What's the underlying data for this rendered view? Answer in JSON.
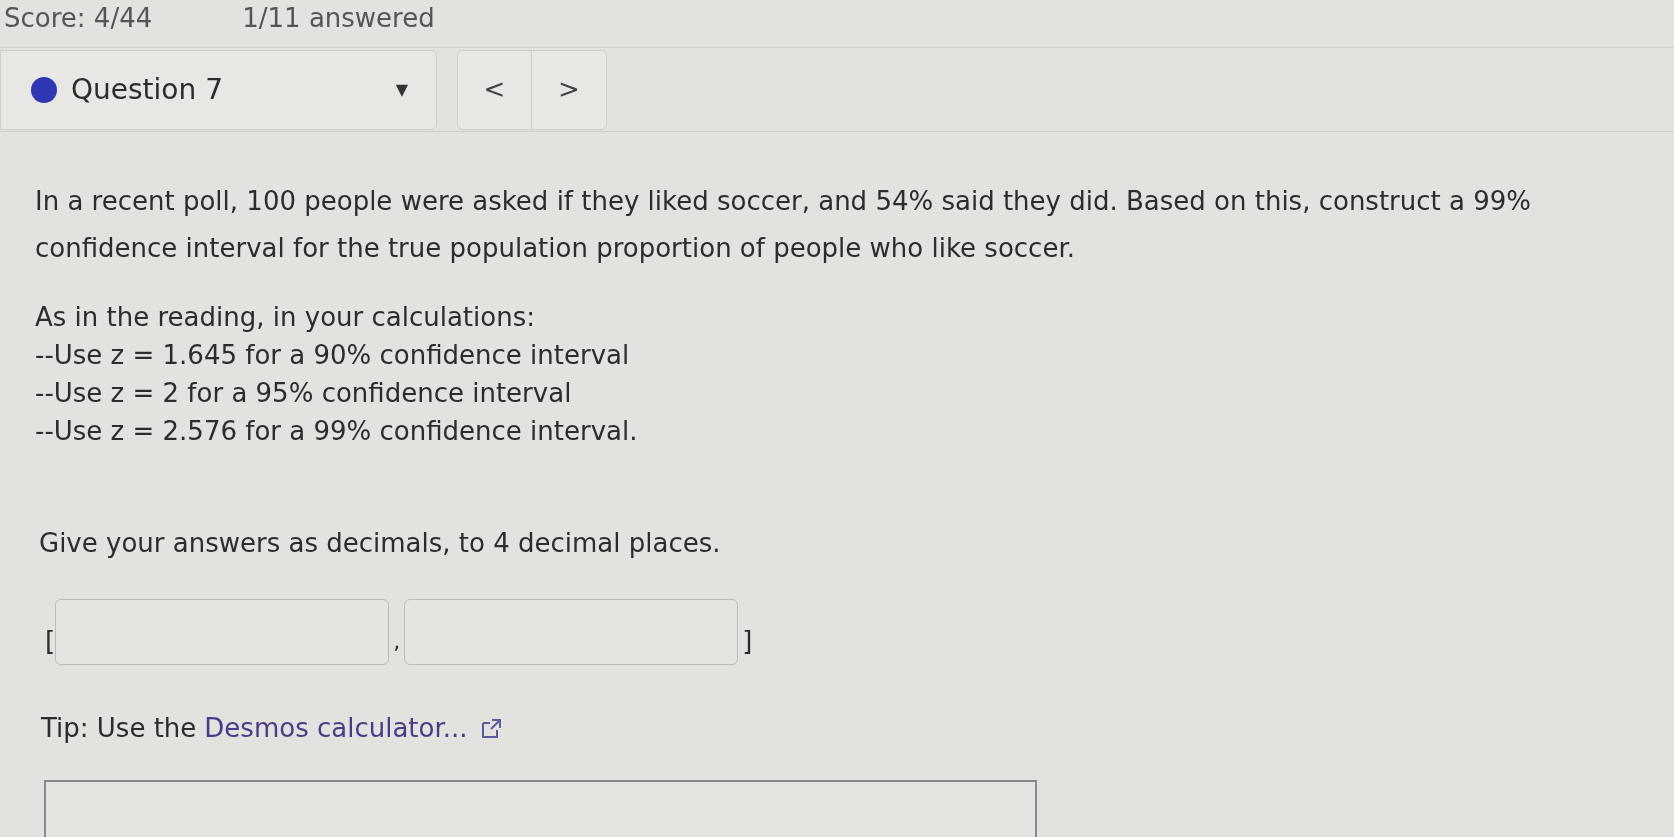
{
  "header": {
    "score": "Score: 4/44",
    "answered": "1/11 answered"
  },
  "question_selector": {
    "color": "#2f37b5",
    "label": "Question 7",
    "caret": "▼"
  },
  "nav": {
    "prev": "<",
    "next": ">"
  },
  "question": {
    "paragraphs": [
      "In a recent poll, 100 people were asked if they liked soccer, and 54% said they did. Based on this, construct a 99% confidence interval for the true population proportion of people who like soccer."
    ],
    "instructions": [
      "As in the reading, in your calculations:",
      "--Use z = 1.645 for a 90% confidence interval",
      "--Use z = 2 for a 95% confidence interval",
      "--Use z = 2.576 for a 99% confidence interval."
    ],
    "prompt": "Give your answers as decimals, to 4 decimal places."
  },
  "answer": {
    "open": "[",
    "separator": ",",
    "close": "]"
  },
  "tip": {
    "label": "Tip: Use the",
    "link": "Desmos calculator..."
  }
}
